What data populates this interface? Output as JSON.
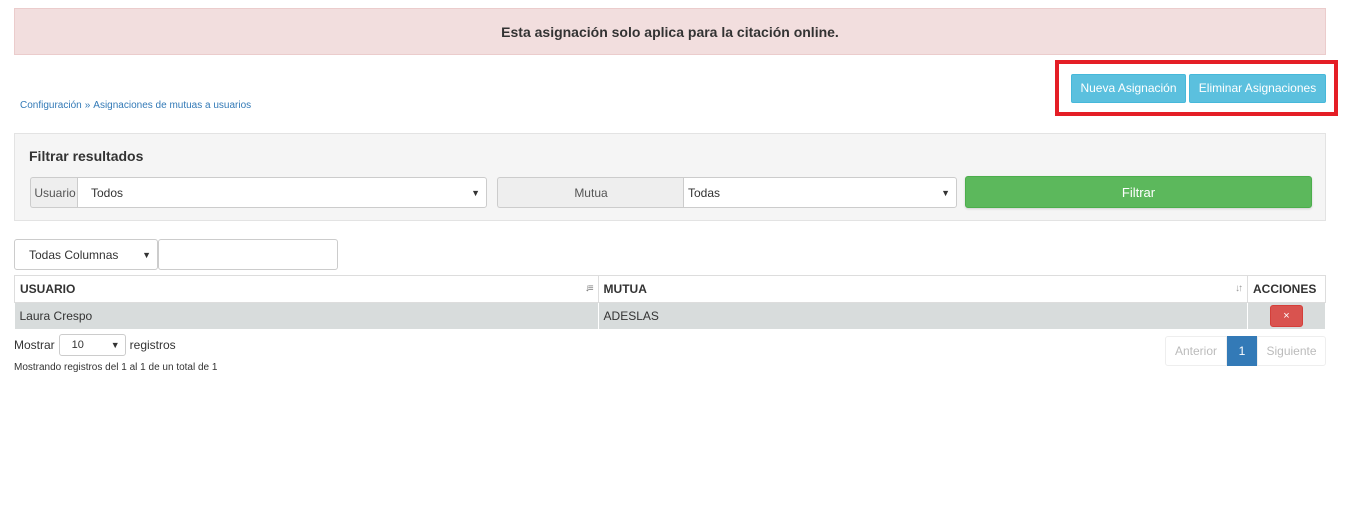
{
  "alert": {
    "text": "Esta asignación solo aplica para la citación online."
  },
  "toolbar": {
    "new_label": "Nueva Asignación",
    "delete_label": "Eliminar Asignaciones"
  },
  "breadcrumb": {
    "items": [
      "Configuración",
      "Asignaciones de mutuas a usuarios"
    ],
    "separator": "»"
  },
  "filter": {
    "title": "Filtrar resultados",
    "usuario_label": "Usuario",
    "usuario_value": "Todos",
    "mutua_label": "Mutua",
    "mutua_value": "Todas",
    "button_label": "Filtrar"
  },
  "search": {
    "columns_value": "Todas Columnas",
    "input_value": ""
  },
  "table": {
    "headers": [
      "USUARIO",
      "MUTUA",
      "ACCIONES"
    ],
    "rows": [
      {
        "usuario": "Laura Crespo",
        "mutua": "ADESLAS",
        "action_icon": "×"
      }
    ]
  },
  "length": {
    "prefix": "Mostrar",
    "value": "10",
    "suffix": "registros"
  },
  "info": {
    "text": "Mostrando registros del 1 al 1 de un total de 1"
  },
  "pagination": {
    "prev": "Anterior",
    "current": "1",
    "next": "Siguiente"
  },
  "colors": {
    "alert_bg": "#f2dede",
    "info_button": "#5bc0de",
    "success_button": "#5cb85c",
    "danger_button": "#d9534f",
    "highlight": "#e41e26",
    "primary": "#337ab7"
  },
  "icons": {
    "caret": "caret-down-icon",
    "sort_asc": "sort-asc-icon",
    "sort_both": "sort-icon",
    "delete": "close-icon"
  }
}
